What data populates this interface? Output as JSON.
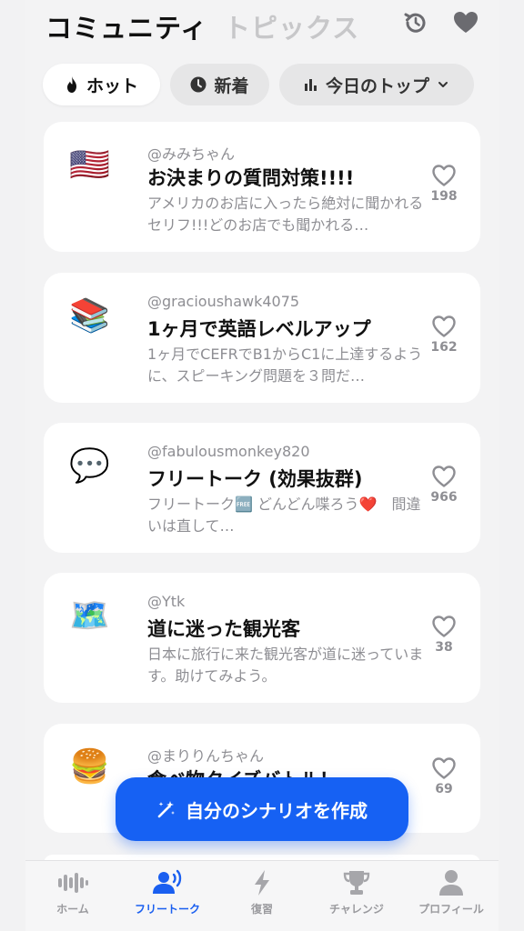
{
  "header": {
    "title": "コミュニティ",
    "subtitle": "トピックス"
  },
  "filters": {
    "hot": "ホット",
    "new": "新着",
    "top": "今日のトップ"
  },
  "posts": [
    {
      "emoji": "🇺🇸",
      "user": "@みみちゃん",
      "title": "お決まりの質問対策!!!!",
      "desc": "アメリカのお店に入ったら絶対に聞かれるセリフ!!!どのお店でも聞かれる…",
      "likes": "198"
    },
    {
      "emoji": "📚",
      "user": "@gracioushawk4075",
      "title": "1ヶ月で英語レベルアップ",
      "desc": "1ヶ月でCEFRでB1からC1に上達するように、スピーキング問題を３問だ…",
      "likes": "162"
    },
    {
      "emoji": "💬",
      "user": "@fabulousmonkey820",
      "title": "フリートーク (効果抜群)",
      "desc": "フリートーク🆓 どんどん喋ろう❤️　間違いは直して…",
      "likes": "966"
    },
    {
      "emoji": "🗺️",
      "user": "@Ytk",
      "title": "道に迷った観光客",
      "desc": "日本に旅行に来た観光客が道に迷っています。助けてみよう。",
      "likes": "38"
    },
    {
      "emoji": "🍔",
      "user": "@まりりんちゃん",
      "title": "食べ物クイズバトル！",
      "desc": "",
      "likes": "69"
    }
  ],
  "cta": {
    "label": "自分のシナリオを作成"
  },
  "tabs": [
    {
      "label": "ホーム"
    },
    {
      "label": "フリートーク"
    },
    {
      "label": "復習"
    },
    {
      "label": "チャレンジ"
    },
    {
      "label": "プロフィール"
    }
  ],
  "colors": {
    "accent": "#1661f3",
    "muted": "#8e8e93",
    "inactive_title": "#c7c7c9"
  }
}
